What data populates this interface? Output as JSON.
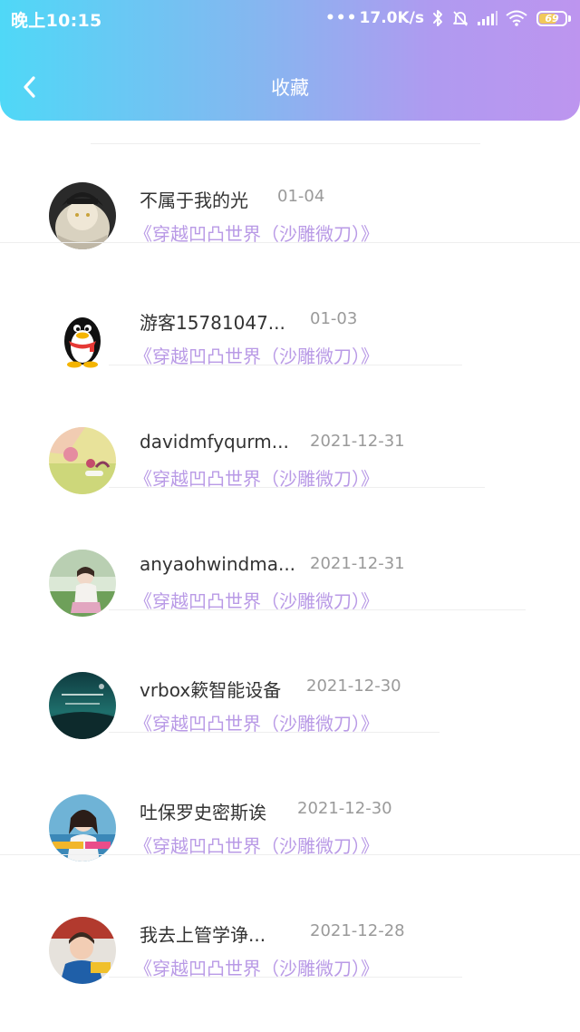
{
  "status_bar": {
    "time": "晚上10:15",
    "network_speed": "17.0K/s",
    "battery_level": "69",
    "battery_color": "#f1c95b"
  },
  "header": {
    "title": "收藏",
    "back_icon": "chevron-left-icon",
    "gradient_start": "#4fd8f7",
    "gradient_end": "#bd95ef"
  },
  "favorites": [
    {
      "name": "不属于我的光",
      "date": "01-04",
      "book": "《穿越凹凸世界（沙雕微刀）》"
    },
    {
      "name": "游客15781047...",
      "date": "01-03",
      "book": "《穿越凹凸世界（沙雕微刀）》"
    },
    {
      "name": "davidmfyqurm...",
      "date": "2021-12-31",
      "book": "《穿越凹凸世界（沙雕微刀）》"
    },
    {
      "name": "anyaohwindma...",
      "date": "2021-12-31",
      "book": "《穿越凹凸世界（沙雕微刀）》"
    },
    {
      "name": "vrbox簌智能设备",
      "date": "2021-12-30",
      "book": "《穿越凹凸世界（沙雕微刀）》"
    },
    {
      "name": "吐保罗史密斯诶",
      "date": "2021-12-30",
      "book": "《穿越凹凸世界（沙雕微刀）》"
    },
    {
      "name": "我去上管学诤...",
      "date": "2021-12-28",
      "book": "《穿越凹凸世界（沙雕微刀）》"
    }
  ],
  "colors": {
    "name_text": "#333333",
    "date_text": "#9a9a9a",
    "book_text": "#b99ae6"
  }
}
